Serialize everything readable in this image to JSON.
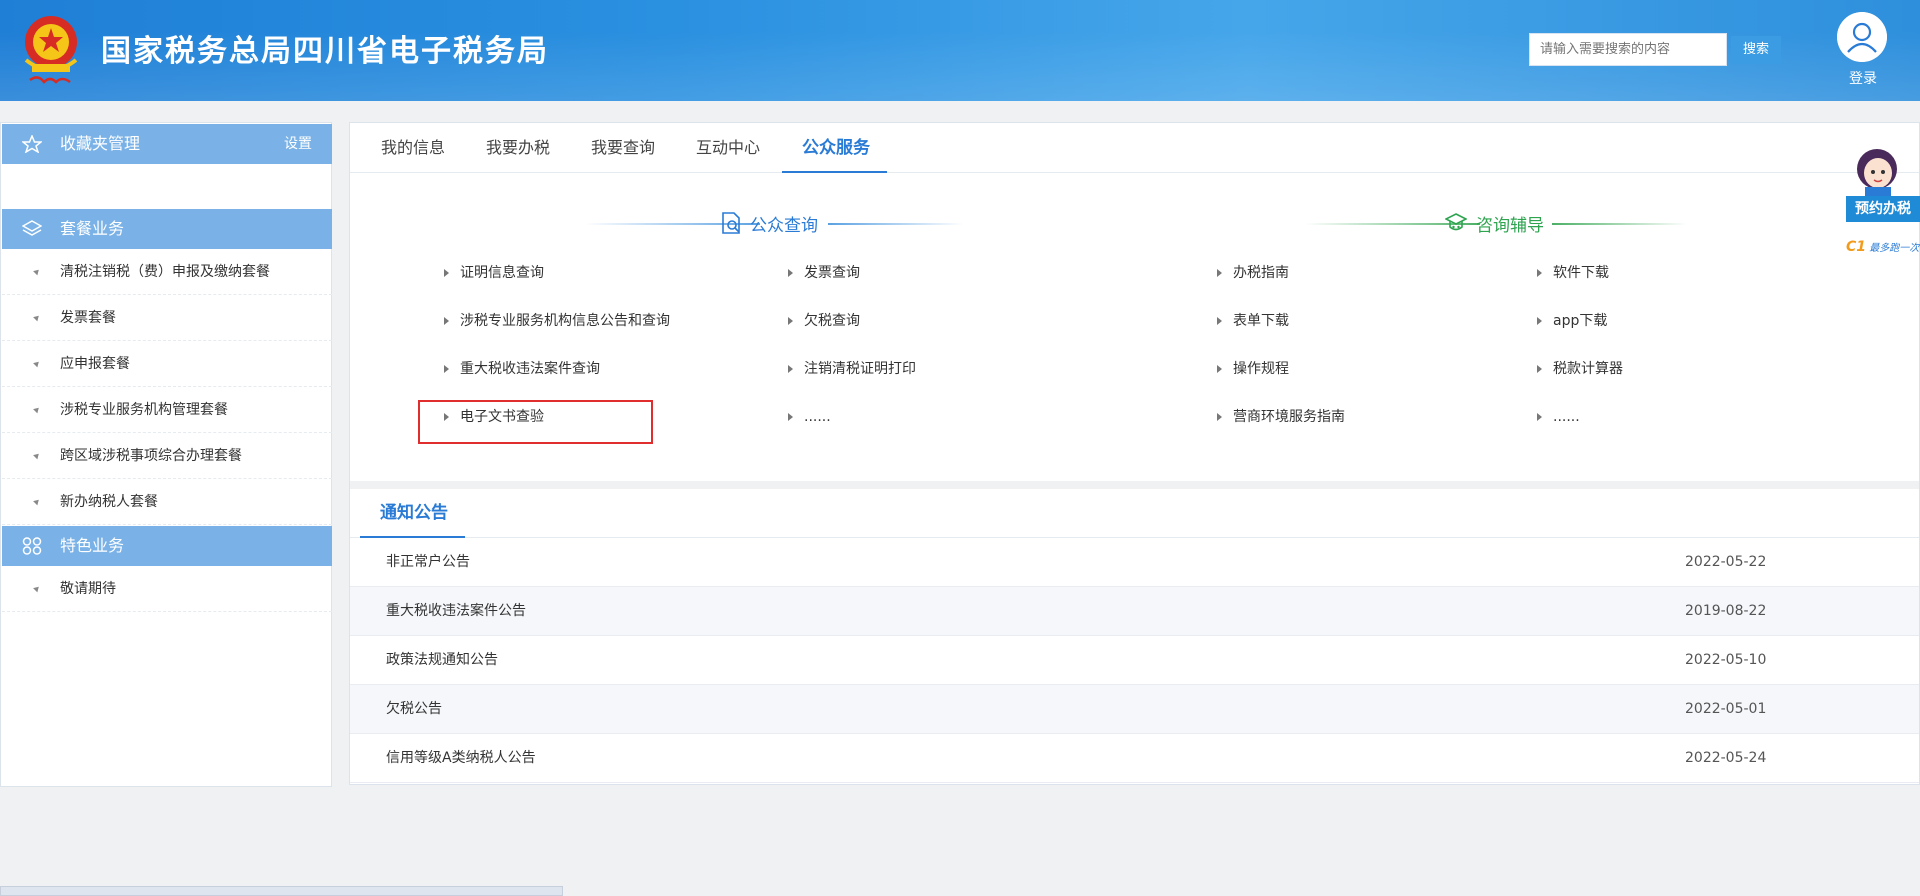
{
  "header": {
    "site_title": "国家税务总局四川省电子税务局",
    "search_placeholder": "请输入需要搜索的内容",
    "search_button": "搜索",
    "login_label": "登录"
  },
  "sidebar": {
    "favorites": {
      "title": "收藏夹管理",
      "settings": "设置"
    },
    "packages": {
      "title": "套餐业务",
      "items": [
        {
          "label": "清税注销税（费）申报及缴纳套餐"
        },
        {
          "label": "发票套餐"
        },
        {
          "label": "应申报套餐"
        },
        {
          "label": "涉税专业服务机构管理套餐"
        },
        {
          "label": "跨区域涉税事项综合办理套餐"
        },
        {
          "label": "新办纳税人套餐"
        }
      ]
    },
    "special": {
      "title": "特色业务",
      "items": [
        {
          "label": "敬请期待"
        }
      ]
    }
  },
  "tabs": [
    {
      "label": "我的信息"
    },
    {
      "label": "我要办税"
    },
    {
      "label": "我要查询"
    },
    {
      "label": "互动中心"
    },
    {
      "label": "公众服务",
      "active": true
    }
  ],
  "public_query": {
    "title": "公众查询",
    "col1": [
      "证明信息查询",
      "涉税专业服务机构信息公告和查询",
      "重大税收违法案件查询",
      "电子文书查验"
    ],
    "col2": [
      "发票查询",
      "欠税查询",
      "注销清税证明打印",
      "......"
    ]
  },
  "consult": {
    "title": "咨询辅导",
    "col1": [
      "办税指南",
      "表单下载",
      "操作规程",
      "营商环境服务指南"
    ],
    "col2": [
      "软件下载",
      "app下载",
      "税款计算器",
      "......"
    ]
  },
  "notices": {
    "title": "通知公告",
    "rows": [
      {
        "title": "非正常户公告",
        "date": "2022-05-22"
      },
      {
        "title": "重大税收违法案件公告",
        "date": "2019-08-22"
      },
      {
        "title": "政策法规通知公告",
        "date": "2022-05-10"
      },
      {
        "title": "欠税公告",
        "date": "2022-05-01"
      },
      {
        "title": "信用等级A类纳税人公告",
        "date": "2022-05-24"
      }
    ]
  },
  "floating": {
    "appointment": "预约办税",
    "slogan": "最多跑一次"
  },
  "colors": {
    "primary": "#2a7bd5",
    "header_blue": "#2a90e0",
    "sidebar_head": "#7ab2e7",
    "consult_green": "#2ea44f",
    "highlight_red": "#e02e2e"
  }
}
